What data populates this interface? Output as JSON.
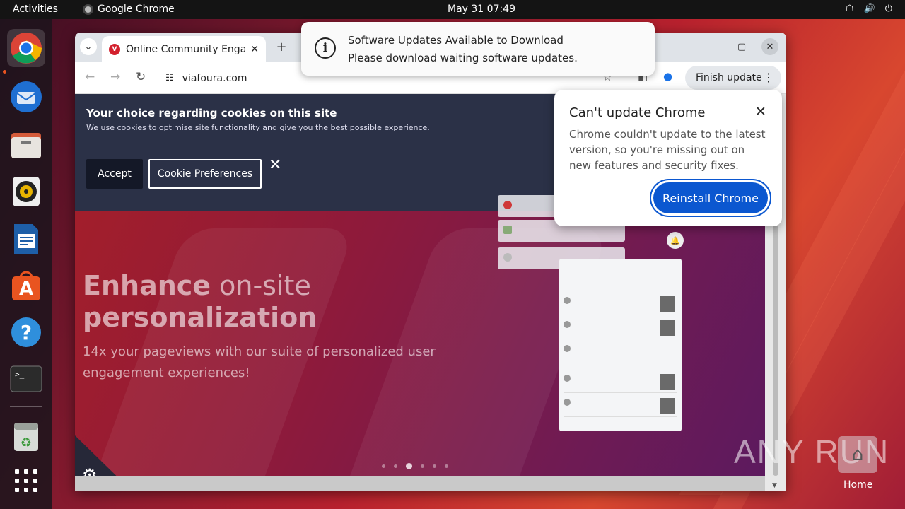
{
  "topbar": {
    "activities": "Activities",
    "app_name": "Google Chrome",
    "clock": "May 31  07:49"
  },
  "dock": {
    "items": [
      {
        "name": "Google Chrome",
        "icon": "chrome-icon",
        "active": true
      },
      {
        "name": "Thunderbird",
        "icon": "thunderbird-icon"
      },
      {
        "name": "Files",
        "icon": "files-icon"
      },
      {
        "name": "Rhythmbox",
        "icon": "rhythmbox-icon"
      },
      {
        "name": "LibreOffice Writer",
        "icon": "writer-icon"
      },
      {
        "name": "Ubuntu Software",
        "icon": "software-icon"
      },
      {
        "name": "Help",
        "icon": "help-icon"
      },
      {
        "name": "Terminal",
        "icon": "terminal-icon"
      },
      {
        "name": "Trash",
        "icon": "trash-icon"
      },
      {
        "name": "Show Applications",
        "icon": "app-grid-icon"
      }
    ]
  },
  "browser": {
    "tab_title": "Online Community Enga",
    "url": "viafoura.com",
    "finish_update_label": "Finish update"
  },
  "cookie_banner": {
    "title": "Your choice regarding cookies on this site",
    "text": "We use cookies to optimise site functionality and give you the best possible experience.",
    "accept_label": "Accept",
    "prefs_label": "Cookie Preferences"
  },
  "hero": {
    "line1_bold": "Enhance",
    "line1_rest": " on-site",
    "line2": "personalization",
    "subtitle": "14x your pageviews with our suite of personalized user engagement experiences!"
  },
  "carousel": {
    "count": 6,
    "active_index": 2
  },
  "update_popup": {
    "title": "Can't update Chrome",
    "body": "Chrome couldn't update to the latest version, so you're missing out on new features and security fixes.",
    "button": "Reinstall Chrome"
  },
  "notification": {
    "title": "Software Updates Available to Download",
    "body": "Please download waiting software updates."
  },
  "desktop": {
    "home_label": "Home",
    "watermark": "ANY RUN"
  },
  "colors": {
    "accent_blue": "#0b57d0",
    "cookie_bg": "#2b3147",
    "ubuntu_orange": "#e95420"
  }
}
